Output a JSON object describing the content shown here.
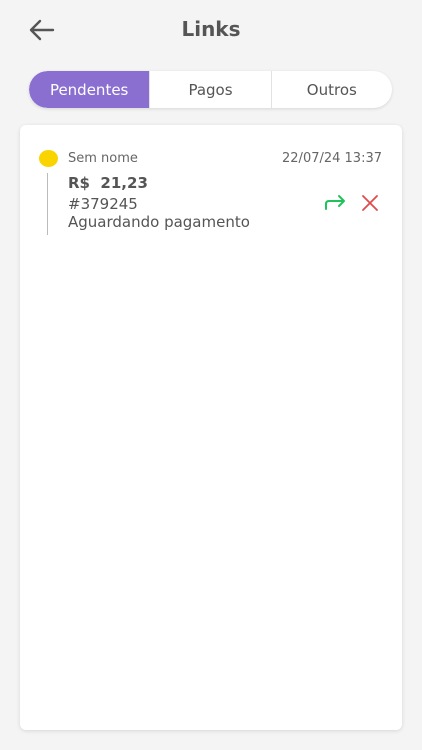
{
  "header": {
    "title": "Links",
    "back_icon": "arrow-left-icon"
  },
  "tabs": [
    {
      "label": "Pendentes",
      "active": true
    },
    {
      "label": "Pagos",
      "active": false
    },
    {
      "label": "Outros",
      "active": false
    }
  ],
  "links": [
    {
      "name": "Sem nome",
      "date": "22/07/24 13:37",
      "amount": "R$  21,23",
      "id": "#379245",
      "status": "Aguardando pagamento",
      "status_color": "#fad400",
      "share_icon": "share-arrow-icon",
      "cancel_icon": "close-icon"
    }
  ],
  "colors": {
    "accent": "#8a6fd1",
    "share": "#22c25a",
    "cancel": "#e14a4a",
    "pending": "#fad400"
  }
}
